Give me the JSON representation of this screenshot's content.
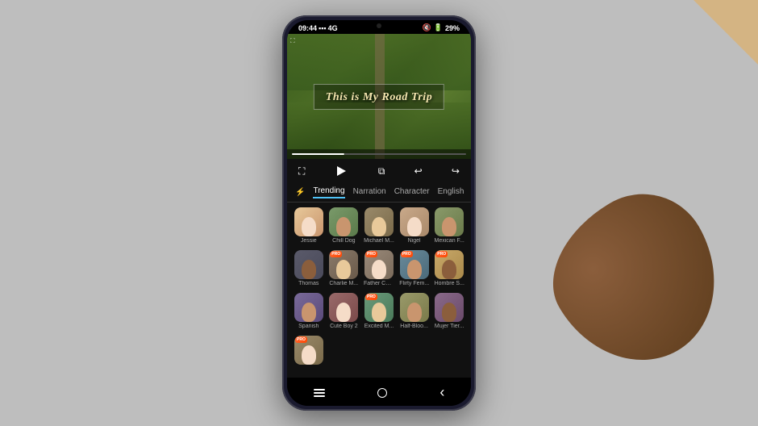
{
  "surface": {
    "bg_color": "#bebebe"
  },
  "status_bar": {
    "time": "09:44",
    "signal": "4G",
    "battery": "29%"
  },
  "video": {
    "title": "This is My Road Trip"
  },
  "controls": {
    "fullscreen": "⛶",
    "play": "▶",
    "copy": "⧉",
    "undo": "↩",
    "redo": "↪"
  },
  "tabs": {
    "filter_icon": "⚡",
    "items": [
      {
        "label": "Trending",
        "active": true
      },
      {
        "label": "Narration",
        "active": false
      },
      {
        "label": "Character",
        "active": false
      },
      {
        "label": "English",
        "active": false
      }
    ],
    "check": "✓"
  },
  "voices": {
    "row1": [
      {
        "name": "Jessie",
        "pro": false,
        "color": "av-1"
      },
      {
        "name": "Chill Dog",
        "pro": false,
        "color": "av-2"
      },
      {
        "name": "Michael M...",
        "pro": false,
        "color": "av-3"
      },
      {
        "name": "Nigel",
        "pro": false,
        "color": "av-4"
      },
      {
        "name": "Mexican F...",
        "pro": false,
        "color": "av-5"
      }
    ],
    "row2": [
      {
        "name": "Thomas",
        "pro": false,
        "color": "av-6"
      },
      {
        "name": "Charlie M...",
        "pro": true,
        "color": "av-7"
      },
      {
        "name": "Father Chr...",
        "pro": true,
        "color": "av-8"
      },
      {
        "name": "Flirty Fem...",
        "pro": true,
        "color": "av-9"
      },
      {
        "name": "Hombre S...",
        "pro": true,
        "color": "av-10"
      }
    ],
    "row3": [
      {
        "name": "Spanish",
        "pro": false,
        "color": "av-11"
      },
      {
        "name": "Cute Boy 2",
        "pro": false,
        "color": "av-12"
      },
      {
        "name": "Excited M...",
        "pro": true,
        "color": "av-13"
      },
      {
        "name": "Half-Bloo...",
        "pro": false,
        "color": "av-14"
      },
      {
        "name": "Mujer Tier...",
        "pro": false,
        "color": "av-15"
      }
    ],
    "row4": [
      {
        "name": "",
        "pro": true,
        "color": "av-1"
      }
    ]
  },
  "nav": {
    "back": "‹"
  }
}
